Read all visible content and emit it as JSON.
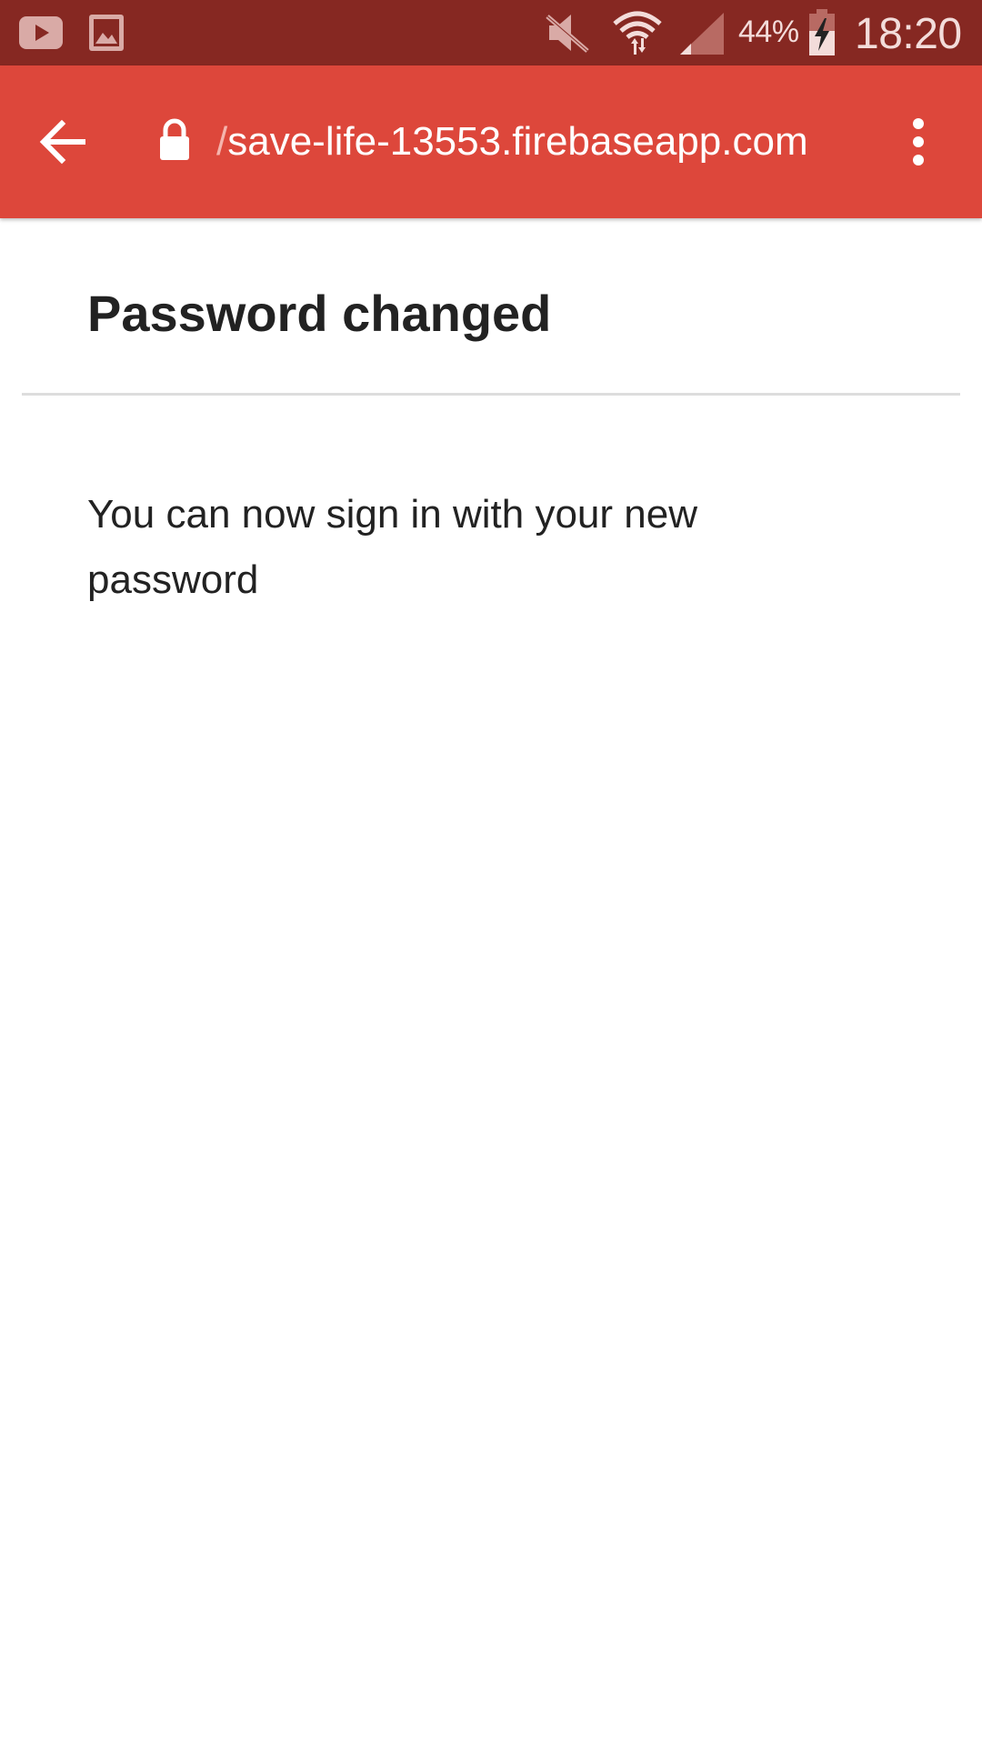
{
  "status_bar": {
    "left_icons": [
      "youtube-icon",
      "gallery-icon"
    ],
    "right_icons": [
      "mute-icon",
      "wifi-icon",
      "signal-icon",
      "battery-charging-icon"
    ],
    "battery_percent": "44%",
    "time": "18:20"
  },
  "browser": {
    "url_prefix": "/",
    "url": "save-life-13553.firebaseapp.com",
    "secure": true,
    "back_icon": "arrow-back-icon",
    "menu_icon": "more-vert-icon"
  },
  "page": {
    "title": "Password changed",
    "message": "You can now sign in with your new password"
  },
  "colors": {
    "status_bar": "#862822",
    "toolbar": "#dd473b",
    "text": "#222222"
  }
}
